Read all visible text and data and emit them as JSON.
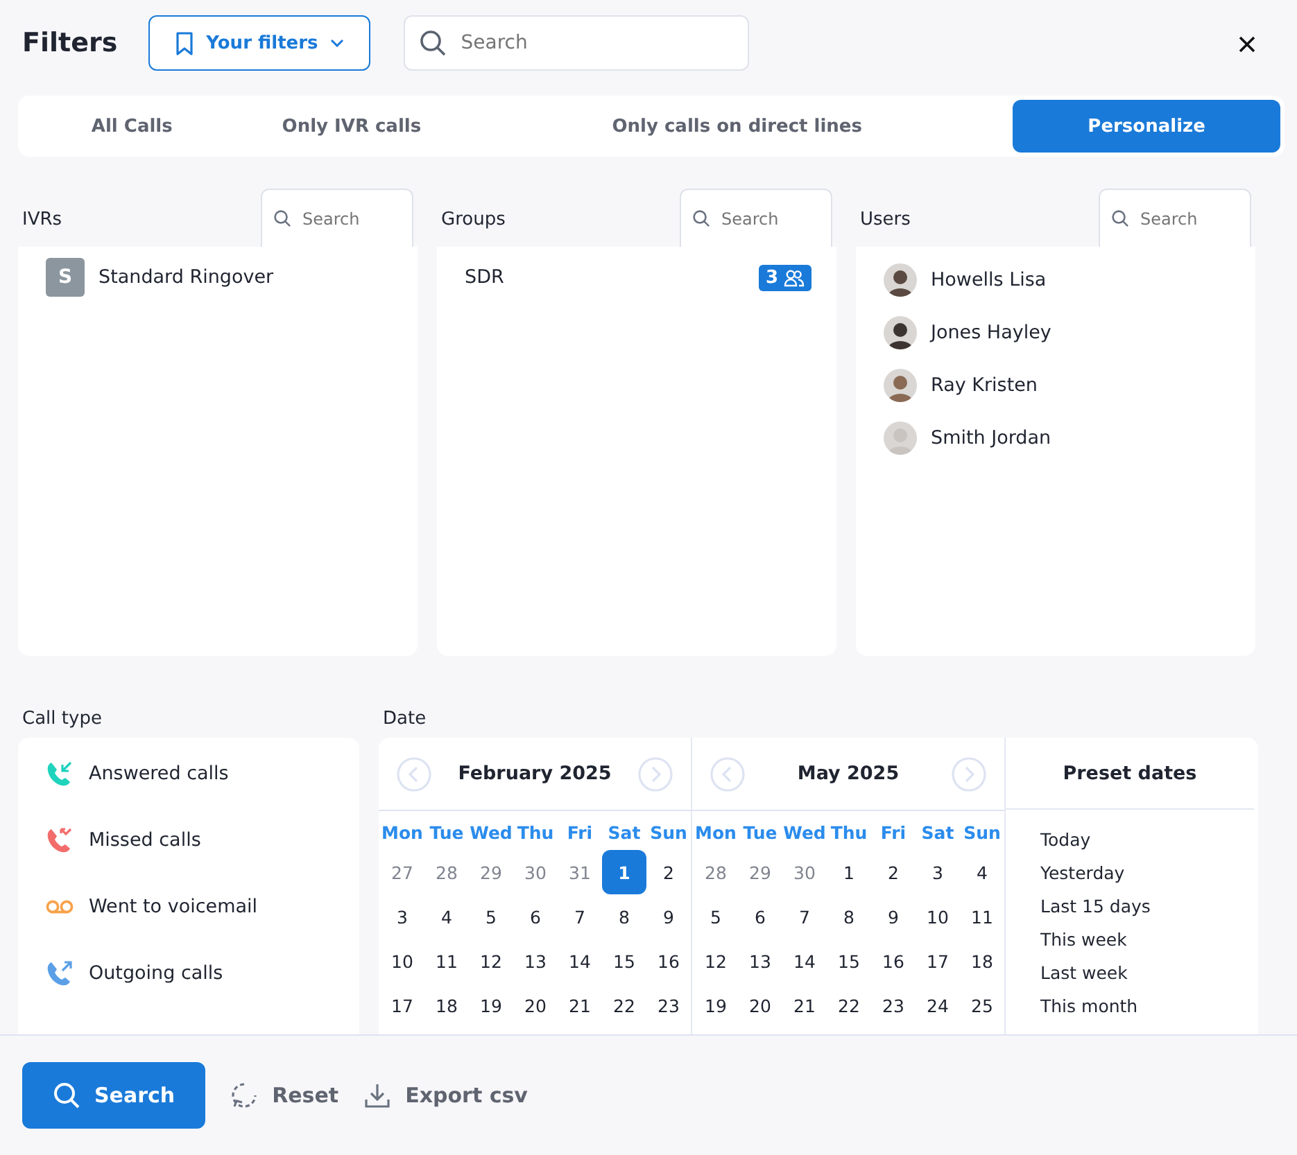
{
  "header": {
    "title": "Filters",
    "filters_button": "Your filters",
    "search": {
      "placeholder": "Search"
    }
  },
  "tabs": [
    {
      "label": "All Calls",
      "selected": false
    },
    {
      "label": "Only IVR calls",
      "selected": false
    },
    {
      "label": "Only calls on direct lines",
      "selected": false
    },
    {
      "label": "Personalize",
      "selected": true
    }
  ],
  "panels": [
    {
      "title": "IVRs",
      "search": {
        "placeholder": "Search"
      },
      "kind": "ivr",
      "items": [
        {
          "initial": "S",
          "name": "Standard Ringover"
        }
      ]
    },
    {
      "title": "Groups",
      "search": {
        "placeholder": "Search"
      },
      "kind": "group",
      "items": [
        {
          "name": "SDR",
          "count": "3"
        }
      ]
    },
    {
      "title": "Users",
      "search": {
        "placeholder": "Search"
      },
      "kind": "user",
      "items": [
        {
          "name": "Howells Lisa"
        },
        {
          "name": "Jones Hayley"
        },
        {
          "name": "Ray Kristen"
        },
        {
          "name": "Smith Jordan"
        }
      ]
    }
  ],
  "call_type": {
    "title": "Call type",
    "items": [
      {
        "kind": "answered",
        "label": "Answered calls"
      },
      {
        "kind": "missed",
        "label": "Missed calls"
      },
      {
        "kind": "voicemail",
        "label": "Went to voicemail"
      },
      {
        "kind": "outgoing",
        "label": "Outgoing calls"
      }
    ]
  },
  "date": {
    "title": "Date",
    "months": [
      {
        "title": "February 2025",
        "weekdays": [
          "Mon",
          "Tue",
          "Wed",
          "Thu",
          "Fri",
          "Sat",
          "Sun"
        ],
        "weeks": [
          [
            {
              "d": "27",
              "outside": true,
              "selected": false
            },
            {
              "d": "28",
              "outside": true,
              "selected": false
            },
            {
              "d": "29",
              "outside": true,
              "selected": false
            },
            {
              "d": "30",
              "outside": true,
              "selected": false
            },
            {
              "d": "31",
              "outside": true,
              "selected": false
            },
            {
              "d": "1",
              "outside": false,
              "selected": true
            },
            {
              "d": "2",
              "outside": false,
              "selected": false
            }
          ],
          [
            {
              "d": "3",
              "outside": false,
              "selected": false
            },
            {
              "d": "4",
              "outside": false,
              "selected": false
            },
            {
              "d": "5",
              "outside": false,
              "selected": false
            },
            {
              "d": "6",
              "outside": false,
              "selected": false
            },
            {
              "d": "7",
              "outside": false,
              "selected": false
            },
            {
              "d": "8",
              "outside": false,
              "selected": false
            },
            {
              "d": "9",
              "outside": false,
              "selected": false
            }
          ],
          [
            {
              "d": "10",
              "outside": false,
              "selected": false
            },
            {
              "d": "11",
              "outside": false,
              "selected": false
            },
            {
              "d": "12",
              "outside": false,
              "selected": false
            },
            {
              "d": "13",
              "outside": false,
              "selected": false
            },
            {
              "d": "14",
              "outside": false,
              "selected": false
            },
            {
              "d": "15",
              "outside": false,
              "selected": false
            },
            {
              "d": "16",
              "outside": false,
              "selected": false
            }
          ],
          [
            {
              "d": "17",
              "outside": false,
              "selected": false
            },
            {
              "d": "18",
              "outside": false,
              "selected": false
            },
            {
              "d": "19",
              "outside": false,
              "selected": false
            },
            {
              "d": "20",
              "outside": false,
              "selected": false
            },
            {
              "d": "21",
              "outside": false,
              "selected": false
            },
            {
              "d": "22",
              "outside": false,
              "selected": false
            },
            {
              "d": "23",
              "outside": false,
              "selected": false
            }
          ]
        ]
      },
      {
        "title": "May 2025",
        "weekdays": [
          "Mon",
          "Tue",
          "Wed",
          "Thu",
          "Fri",
          "Sat",
          "Sun"
        ],
        "weeks": [
          [
            {
              "d": "28",
              "outside": true,
              "selected": false
            },
            {
              "d": "29",
              "outside": true,
              "selected": false
            },
            {
              "d": "30",
              "outside": true,
              "selected": false
            },
            {
              "d": "1",
              "outside": false,
              "selected": false
            },
            {
              "d": "2",
              "outside": false,
              "selected": false
            },
            {
              "d": "3",
              "outside": false,
              "selected": false
            },
            {
              "d": "4",
              "outside": false,
              "selected": false
            }
          ],
          [
            {
              "d": "5",
              "outside": false,
              "selected": false
            },
            {
              "d": "6",
              "outside": false,
              "selected": false
            },
            {
              "d": "7",
              "outside": false,
              "selected": false
            },
            {
              "d": "8",
              "outside": false,
              "selected": false
            },
            {
              "d": "9",
              "outside": false,
              "selected": false
            },
            {
              "d": "10",
              "outside": false,
              "selected": false
            },
            {
              "d": "11",
              "outside": false,
              "selected": false
            }
          ],
          [
            {
              "d": "12",
              "outside": false,
              "selected": false
            },
            {
              "d": "13",
              "outside": false,
              "selected": false
            },
            {
              "d": "14",
              "outside": false,
              "selected": false
            },
            {
              "d": "15",
              "outside": false,
              "selected": false
            },
            {
              "d": "16",
              "outside": false,
              "selected": false
            },
            {
              "d": "17",
              "outside": false,
              "selected": false
            },
            {
              "d": "18",
              "outside": false,
              "selected": false
            }
          ],
          [
            {
              "d": "19",
              "outside": false,
              "selected": false
            },
            {
              "d": "20",
              "outside": false,
              "selected": false
            },
            {
              "d": "21",
              "outside": false,
              "selected": false
            },
            {
              "d": "22",
              "outside": false,
              "selected": false
            },
            {
              "d": "23",
              "outside": false,
              "selected": false
            },
            {
              "d": "24",
              "outside": false,
              "selected": false
            },
            {
              "d": "25",
              "outside": false,
              "selected": false
            }
          ]
        ]
      }
    ],
    "presets": {
      "title": "Preset dates",
      "items": [
        "Today",
        "Yesterday",
        "Last 15 days",
        "This week",
        "Last week",
        "This month"
      ]
    }
  },
  "footer": {
    "search_button": "Search",
    "reset_button": "Reset",
    "export_button": "Export csv"
  }
}
